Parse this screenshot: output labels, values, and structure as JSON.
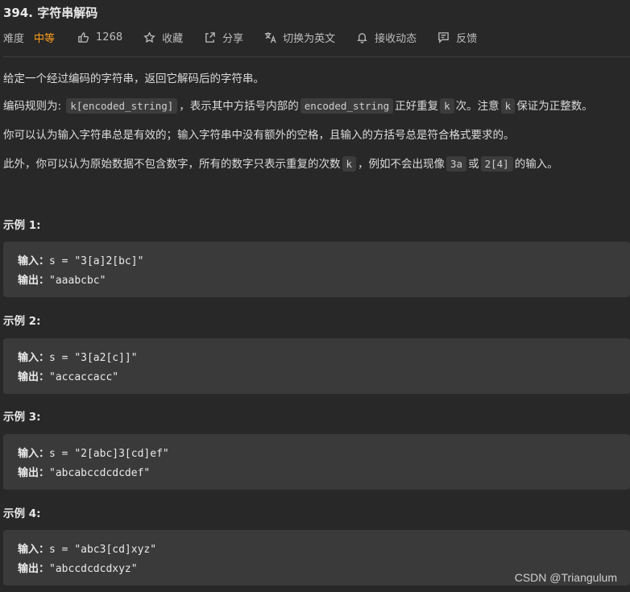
{
  "problem": {
    "title": "394. 字符串解码",
    "difficulty_label": "难度",
    "difficulty_value": "中等",
    "likes": "1268",
    "favorite_label": "收藏",
    "share_label": "分享",
    "translate_label": "切换为英文",
    "subscribe_label": "接收动态",
    "feedback_label": "反馈"
  },
  "description": {
    "p1": "给定一个经过编码的字符串，返回它解码后的字符串。",
    "p2_a": "编码规则为: ",
    "p2_code1": "k[encoded_string]",
    "p2_b": "，表示其中方括号内部的",
    "p2_code2": "encoded_string",
    "p2_c": "正好重复",
    "p2_code3": "k",
    "p2_d": "次。注意",
    "p2_code4": "k",
    "p2_e": "保证为正整数。",
    "p3": "你可以认为输入字符串总是有效的；输入字符串中没有额外的空格，且输入的方括号总是符合格式要求的。",
    "p4_a": "此外，你可以认为原始数据不包含数字，所有的数字只表示重复的次数",
    "p4_code1": "k",
    "p4_b": "，例如不会出现像",
    "p4_code2": "3a",
    "p4_c": "或",
    "p4_code3": "2[4]",
    "p4_d": "的输入。"
  },
  "examples": [
    {
      "title": "示例 1:",
      "input_label": "输入：",
      "input": "s = \"3[a]2[bc]\"",
      "output_label": "输出：",
      "output": "\"aaabcbc\""
    },
    {
      "title": "示例 2:",
      "input_label": "输入：",
      "input": "s = \"3[a2[c]]\"",
      "output_label": "输出：",
      "output": "\"accaccacc\""
    },
    {
      "title": "示例 3:",
      "input_label": "输入：",
      "input": "s = \"2[abc]3[cd]ef\"",
      "output_label": "输出：",
      "output": "\"abcabccdcdcdef\""
    },
    {
      "title": "示例 4:",
      "input_label": "输入：",
      "input": "s = \"abc3[cd]xyz\"",
      "output_label": "输出：",
      "output": "\"abccdcdcdxyz\""
    }
  ],
  "watermark": "CSDN @Triangulum",
  "colors": {
    "background": "#282828",
    "difficulty_medium": "#ff9f1a",
    "code_block_bg": "#3a3a3a"
  },
  "icons": [
    "thumbs-up-icon",
    "star-icon",
    "share-icon",
    "translate-icon",
    "bell-icon",
    "feedback-icon"
  ]
}
